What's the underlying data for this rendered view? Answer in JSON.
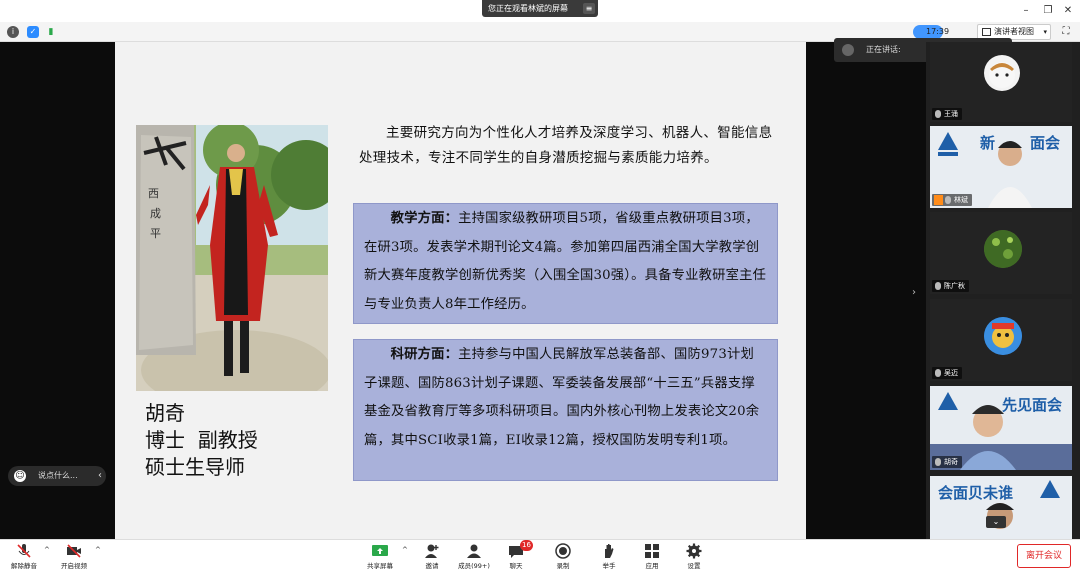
{
  "banner": {
    "text": "您正在观看林斌的屏幕"
  },
  "window": {
    "minimize_icon": "minimize-icon",
    "restore_icon": "restore-icon",
    "close_icon": "close-icon"
  },
  "toolbar2": {
    "timer": "17:39",
    "view_label": "演讲者视图",
    "fullscreen_icon": "fullscreen-icon"
  },
  "slide": {
    "name": "胡奇",
    "title_line": "博士  副教授",
    "role_line": "硕士生导师",
    "intro": "主要研究方向为个性化人才培养及深度学习、机器人、智能信息处理技术，专注不同学生的自身潜质挖掘与素质能力培养。",
    "teaching_head": "教学方面：",
    "teaching_body": "主持国家级教研项目5项，省级重点教研项目3项，在研3项。发表学术期刊论文4篇。参加第四届西浦全国大学教学创新大赛年度教学创新优秀奖（入围全国30强）。具备专业教研室主任与专业负责人8年工作经历。",
    "research_head": "科研方面：",
    "research_body": "主持参与中国人民解放军总装备部、国防973计划子课题、国防863计划子课题、军委装备发展部“十三五”兵器支撑基金及省教育厅等多项科研项目。国内外核心刊物上发表论文20余篇，其中SCI收录1篇，EI收录12篇，授权国防发明专利1项。",
    "stone_text": "西成平"
  },
  "chat": {
    "placeholder": "说点什么..."
  },
  "speaking": {
    "label": "正在讲话:"
  },
  "gallery": {
    "tiles": [
      {
        "name": "王涌"
      },
      {
        "name": "林斌",
        "banner_text": "新  见面会"
      },
      {
        "name": "陈广秋"
      },
      {
        "name": "吴迈"
      },
      {
        "name": "胡奇",
        "banner_text": "先见面会"
      },
      {
        "name": "",
        "banner_text": "会面贝未谁"
      }
    ]
  },
  "bottom": {
    "mute_label": "解除静音",
    "video_label": "开启视频",
    "share_label": "共享屏幕",
    "invite_label": "邀请",
    "members_label": "成员(99+)",
    "chat_label": "聊天",
    "chat_badge": "16",
    "record_label": "录制",
    "raise_label": "举手",
    "apps_label": "应用",
    "settings_label": "设置",
    "leave_label": "离开会议"
  },
  "colors": {
    "accent": "#2d8cff",
    "leave": "#e02828",
    "box_fill": "#a9b1da"
  }
}
